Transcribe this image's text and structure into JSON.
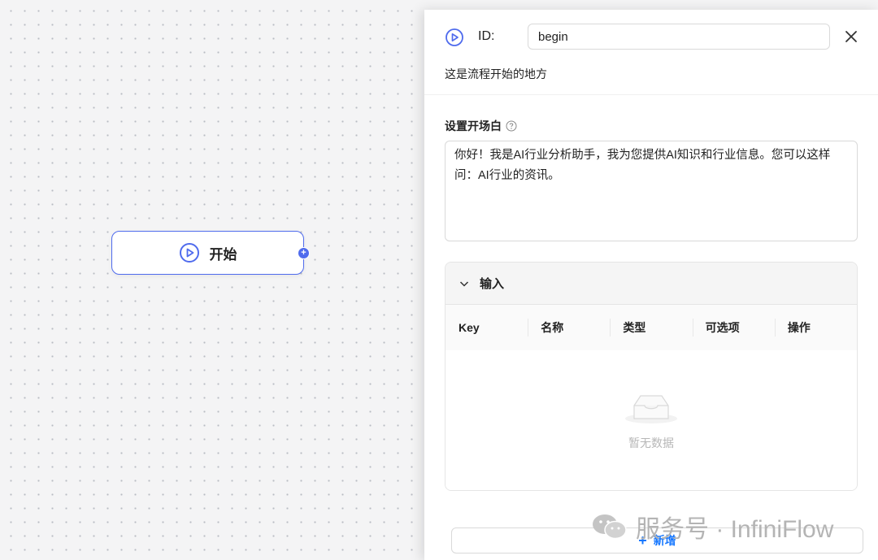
{
  "canvas": {
    "node": {
      "label": "开始",
      "icon": "play-circle-icon",
      "handle_icon": "plus-icon"
    }
  },
  "panel": {
    "icon": "play-circle-icon",
    "id_label": "ID:",
    "id_value": "begin",
    "close_icon": "close-icon",
    "description": "这是流程开始的地方",
    "prologue_label": "设置开场白",
    "prologue_help_icon": "question-circle-icon",
    "prologue_text": "你好！我是AI行业分析助手，我为您提供AI知识和行业信息。您可以这样问：AI行业的资讯。",
    "inputs": {
      "title": "输入",
      "columns": [
        "Key",
        "名称",
        "类型",
        "可选项",
        "操作"
      ],
      "rows": [],
      "empty_text": "暂无数据"
    },
    "add_button": {
      "icon": "plus-icon",
      "label": "新增"
    }
  },
  "watermark": {
    "text": "服务号 · InfiniFlow",
    "icon": "wechat-icon"
  },
  "colors": {
    "accent": "#4f6bed",
    "link": "#1677ff",
    "canvas_bg": "#f4f4f5"
  }
}
